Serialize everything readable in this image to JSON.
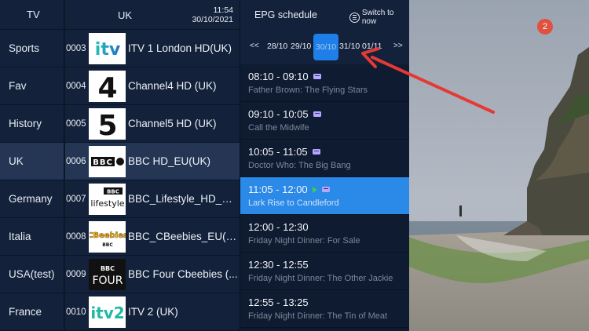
{
  "categories": {
    "header": "TV",
    "items": [
      "Sports",
      "Fav",
      "History",
      "UK",
      "Germany",
      "Italia",
      "USA(test)",
      "France"
    ],
    "selected_index": 3
  },
  "channels": {
    "header": "UK",
    "time": "11:54",
    "date": "30/10/2021",
    "items": [
      {
        "num": "0003",
        "name": "ITV 1 London HD(UK)",
        "logo": "itv-logo"
      },
      {
        "num": "0004",
        "name": "Channel4 HD (UK)",
        "logo": "channel4-logo"
      },
      {
        "num": "0005",
        "name": "Channel5 HD (UK)",
        "logo": "channel5-logo"
      },
      {
        "num": "0006",
        "name": "BBC HD_EU(UK)",
        "logo": "bbc-hd-logo"
      },
      {
        "num": "0007",
        "name": "BBC_Lifestyle_HD_EU...",
        "logo": "bbc-lifestyle-logo"
      },
      {
        "num": "0008",
        "name": "BBC_CBeebies_EU(UK)",
        "logo": "cbeebies-logo"
      },
      {
        "num": "0009",
        "name": "BBC Four Cbeebies (...",
        "logo": "bbc-four-logo"
      },
      {
        "num": "0010",
        "name": "ITV 2 (UK)",
        "logo": "itv2-logo"
      }
    ],
    "selected_index": 3,
    "logo_text": {
      "itv": "itv",
      "c4": "4",
      "c5": "5",
      "bbc": "BBC",
      "lifestyle_bbc": "BBC",
      "lifestyle": "lifestyle",
      "cbeebies": "CBeebies",
      "cbeebies_bbc": "BBC",
      "four_bbc": "BBC",
      "four": "FOUR",
      "itv2": "itv2"
    }
  },
  "epg": {
    "header": "EPG schedule",
    "switch_label": "Switch to now",
    "prev": "<<",
    "next": ">>",
    "dates": [
      "28/10",
      "29/10",
      "30/10",
      "31/10",
      "01/11"
    ],
    "selected_date_index": 2,
    "programs": [
      {
        "time": "08:10 - 09:10",
        "title": "Father Brown: The Flying Stars"
      },
      {
        "time": "09:10 - 10:05",
        "title": "Call the Midwife"
      },
      {
        "time": "10:05 - 11:05",
        "title": "Doctor Who: The Big Bang"
      },
      {
        "time": "11:05 - 12:00",
        "title": "Lark Rise to Candleford"
      },
      {
        "time": "12:00 - 12:30",
        "title": "Friday Night Dinner: For Sale"
      },
      {
        "time": "12:30 - 12:55",
        "title": "Friday Night Dinner: The Other Jackie"
      },
      {
        "time": "12:55 - 13:25",
        "title": "Friday Night Dinner: The Tin of Meat"
      }
    ],
    "selected_program_index": 3
  },
  "preview": {
    "badge": "2"
  },
  "colors": {
    "accent": "#2b89e8",
    "date_selected": "#1e7fe8",
    "panel": "#13213a",
    "selected_row": "#243654",
    "badge": "#e0513f",
    "arrow": "#e53935",
    "playing_icon": "#35d24a"
  }
}
